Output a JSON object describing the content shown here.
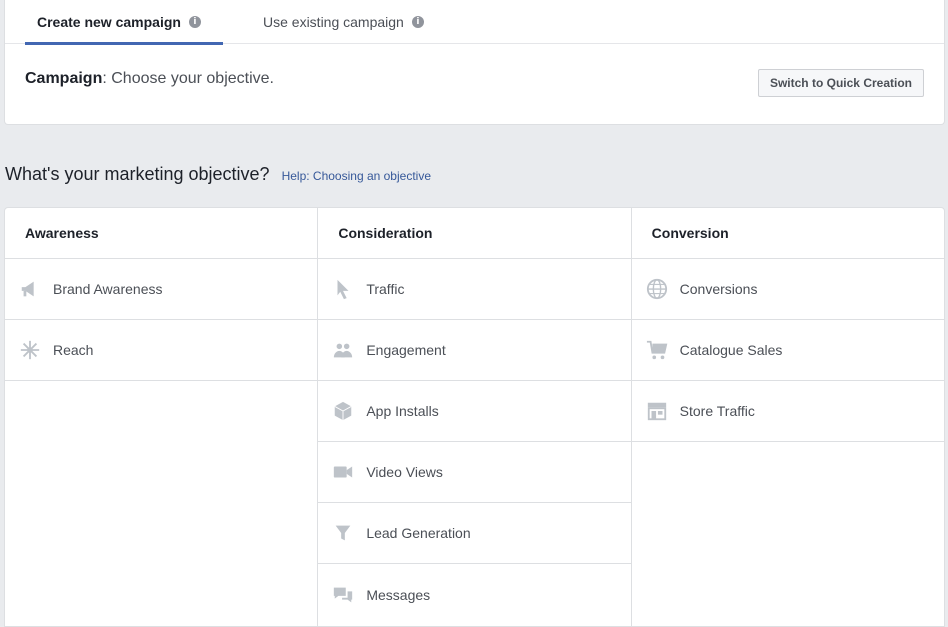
{
  "tabs": {
    "create": "Create new campaign",
    "existing": "Use existing campaign"
  },
  "campaign": {
    "label": "Campaign",
    "text": ": Choose your objective.",
    "quick_button": "Switch to Quick Creation"
  },
  "question": {
    "title": "What's your marketing objective?",
    "help": "Help: Choosing an objective"
  },
  "columns": {
    "awareness": {
      "title": "Awareness",
      "items": [
        "Brand Awareness",
        "Reach"
      ]
    },
    "consideration": {
      "title": "Consideration",
      "items": [
        "Traffic",
        "Engagement",
        "App Installs",
        "Video Views",
        "Lead Generation",
        "Messages"
      ]
    },
    "conversion": {
      "title": "Conversion",
      "items": [
        "Conversions",
        "Catalogue Sales",
        "Store Traffic"
      ]
    }
  },
  "icons": {
    "brand_awareness": "megaphone-icon",
    "reach": "reach-star-icon",
    "traffic": "cursor-icon",
    "engagement": "people-icon",
    "app_installs": "box-icon",
    "video_views": "video-camera-icon",
    "lead_generation": "funnel-icon",
    "messages": "chat-bubbles-icon",
    "conversions": "globe-icon",
    "catalogue_sales": "cart-icon",
    "store_traffic": "store-icon"
  },
  "colors": {
    "accent": "#4267b2",
    "link": "#365899",
    "icon": "#bec3c9"
  }
}
